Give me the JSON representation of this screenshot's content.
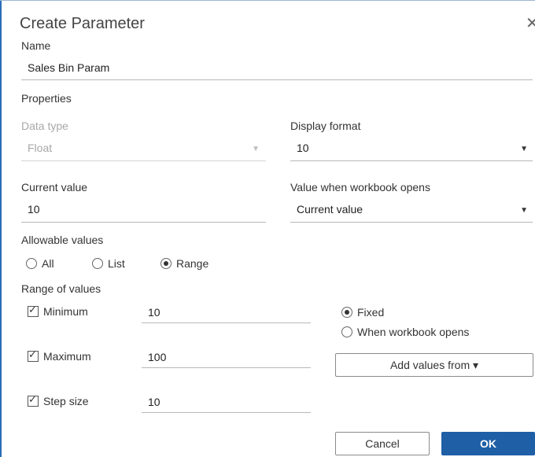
{
  "dialog": {
    "title": "Create Parameter",
    "close_glyph": "✕"
  },
  "name": {
    "label": "Name",
    "value": "Sales Bin Param"
  },
  "properties": {
    "label": "Properties",
    "data_type": {
      "label": "Data type",
      "value": "Float",
      "disabled": true
    },
    "display_format": {
      "label": "Display format",
      "value": "10"
    },
    "current_value": {
      "label": "Current value",
      "value": "10"
    },
    "value_when_opens": {
      "label": "Value when workbook opens",
      "value": "Current value"
    }
  },
  "allowable_values": {
    "label": "Allowable values",
    "options": [
      "All",
      "List",
      "Range"
    ],
    "selected": "Range"
  },
  "range": {
    "label": "Range of values",
    "minimum": {
      "label": "Minimum",
      "checked": true,
      "value": "10"
    },
    "maximum": {
      "label": "Maximum",
      "checked": true,
      "value": "100"
    },
    "step_size": {
      "label": "Step size",
      "checked": true,
      "value": "10"
    },
    "fixed_options": [
      "Fixed",
      "When workbook opens"
    ],
    "fixed_selected": "Fixed",
    "add_values_label": "Add values from ▾"
  },
  "buttons": {
    "cancel": "Cancel",
    "ok": "OK"
  },
  "colors": {
    "accent": "#1f5fa6",
    "frame": "#2a6db8"
  },
  "icons": {
    "dropdown": "caret-down-icon",
    "close": "close-icon"
  }
}
